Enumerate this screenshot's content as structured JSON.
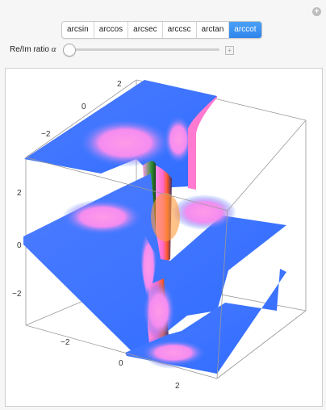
{
  "tabs": [
    {
      "label": "arcsin",
      "active": false
    },
    {
      "label": "arccos",
      "active": false
    },
    {
      "label": "arcsec",
      "active": false
    },
    {
      "label": "arccsc",
      "active": false
    },
    {
      "label": "arctan",
      "active": false
    },
    {
      "label": "arccot",
      "active": true
    }
  ],
  "slider": {
    "label": "Re/Im ratio",
    "symbol": "α",
    "value": 0
  },
  "axes": {
    "top_back": [
      "2",
      "0",
      "−2"
    ],
    "left_vertical": [
      "2",
      "0",
      "−2"
    ],
    "bottom_front_left": [
      "−2",
      "0"
    ],
    "bottom_front_right": [
      "2"
    ]
  },
  "colors": {
    "accent": "#2f84ec",
    "surface_blue": "#3a7cff",
    "surface_pink": "#ff88e6",
    "surface_orange": "#ff6a2a"
  }
}
